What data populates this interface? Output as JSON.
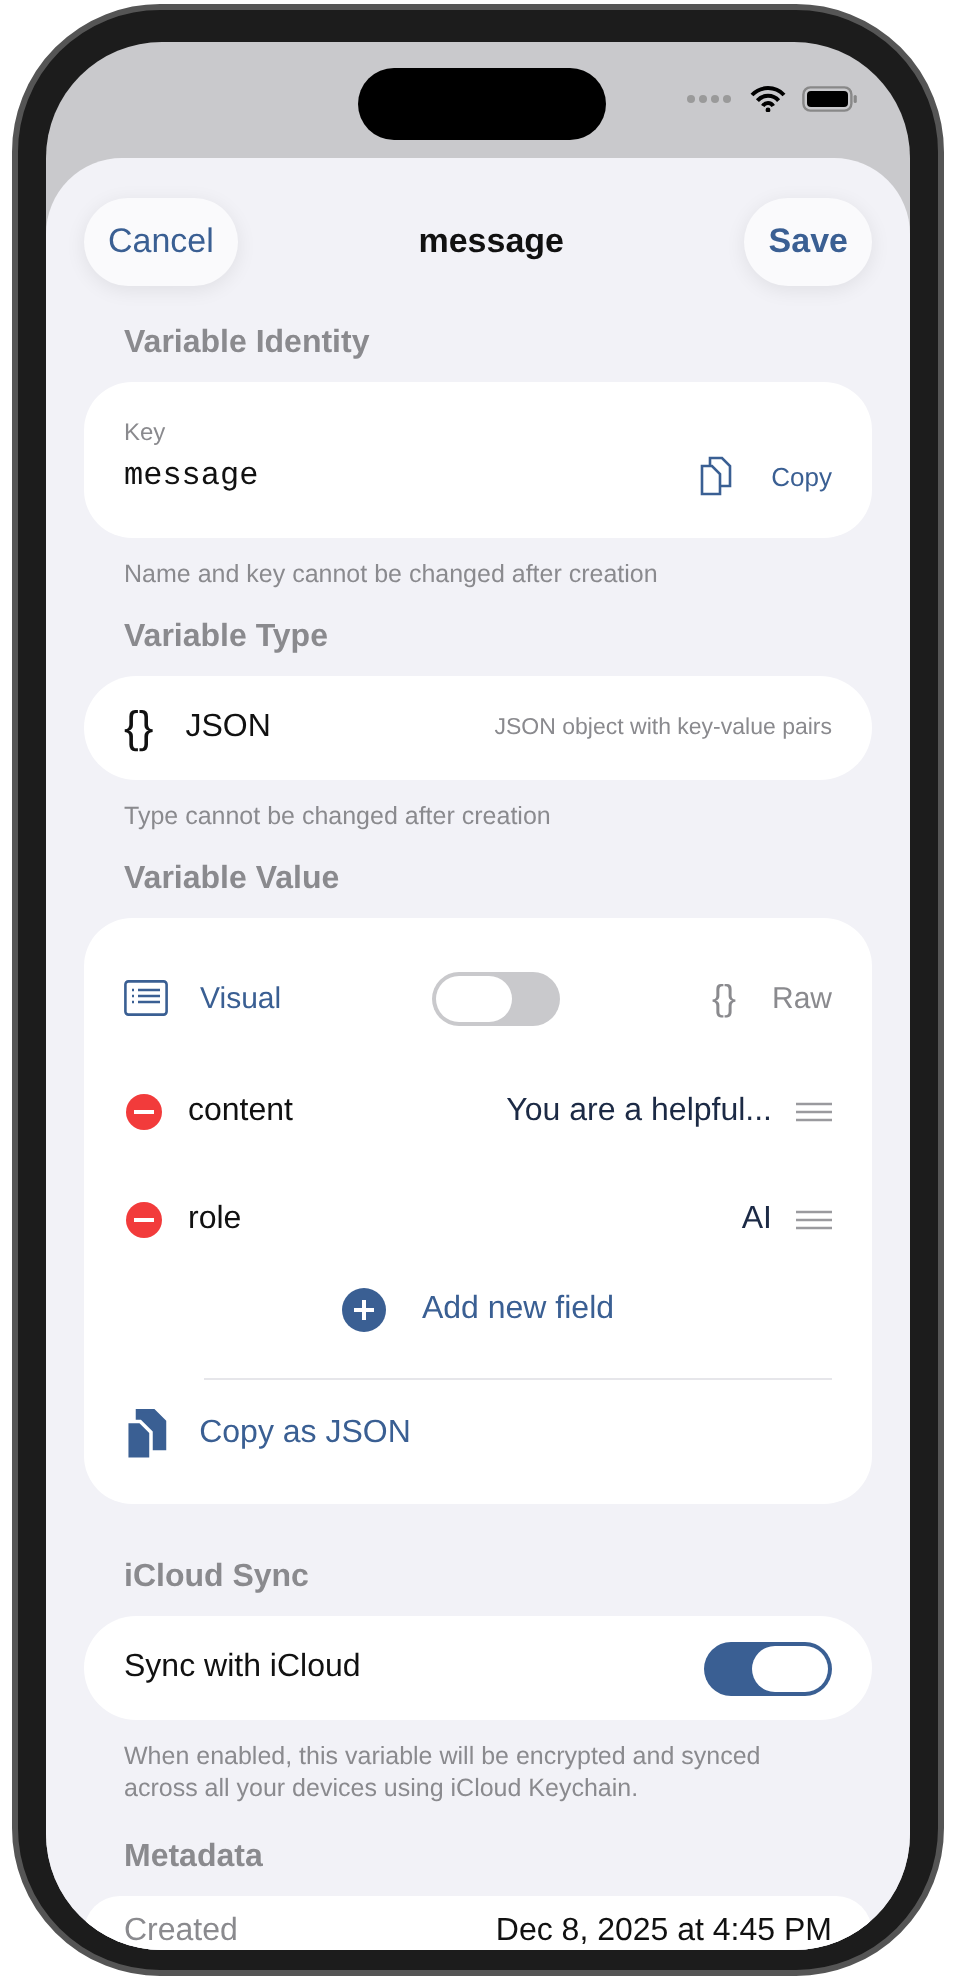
{
  "nav": {
    "cancel": "Cancel",
    "title": "message",
    "save": "Save"
  },
  "identity": {
    "header": "Variable Identity",
    "key_label": "Key",
    "key_value": "message",
    "copy": "Copy",
    "note": "Name and key cannot be changed after creation"
  },
  "type": {
    "header": "Variable Type",
    "icon": "{}",
    "name": "JSON",
    "description": "JSON object with key-value pairs",
    "note": "Type cannot be changed after creation"
  },
  "value": {
    "header": "Variable Value",
    "visual": "Visual",
    "raw_icon": "{}",
    "raw": "Raw",
    "raw_on": false,
    "fields": [
      {
        "key": "content",
        "value": "You are a helpful..."
      },
      {
        "key": "role",
        "value": "AI"
      }
    ],
    "add": "Add new field",
    "copy": "Copy as JSON"
  },
  "sync": {
    "header": "iCloud Sync",
    "label": "Sync with iCloud",
    "on": true,
    "note": "When enabled, this variable will be encrypted and synced across all your devices using iCloud Keychain."
  },
  "metadata": {
    "header": "Metadata",
    "rows": [
      {
        "label": "Created",
        "value": "Dec 8, 2025 at 4:45 PM"
      }
    ]
  }
}
